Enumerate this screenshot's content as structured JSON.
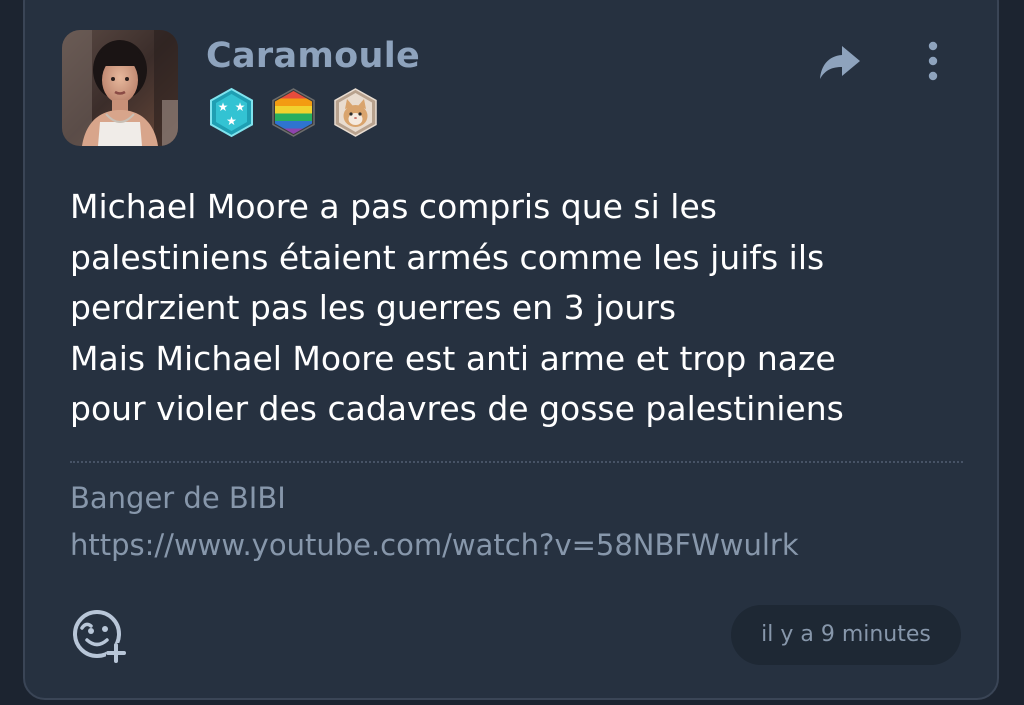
{
  "post": {
    "author": {
      "username": "Caramoule",
      "avatar_icon": "user-photo-avatar",
      "badges": [
        {
          "icon": "stars-hexagon-badge",
          "color": "#2bb7c8"
        },
        {
          "icon": "rainbow-hexagon-badge",
          "color": "#e7a533"
        },
        {
          "icon": "cat-hexagon-badge",
          "color": "#d8b79a"
        }
      ]
    },
    "actions": {
      "share_icon": "share-icon",
      "more_icon": "more-vertical-icon"
    },
    "content": {
      "lines": [
        "Michael Moore a pas compris que si les",
        "palestiniens étaient armés comme les juifs ils",
        "perdrzient pas les guerres en 3 jours",
        "Mais Michael Moore est anti arme et trop naze",
        "pour violer des cadavres de gosse palestiniens"
      ]
    },
    "embed": {
      "title": "Banger de BIBI",
      "url": "https://www.youtube.com/watch?v=58NBFWwulrk"
    },
    "footer": {
      "react_icon": "add-reaction-icon",
      "timestamp": "il y a 9 minutes"
    }
  },
  "colors": {
    "background": "#1c2430",
    "card": "#263140",
    "username": "#8ea3bd",
    "text": "#ffffff",
    "muted": "#8797ab"
  }
}
